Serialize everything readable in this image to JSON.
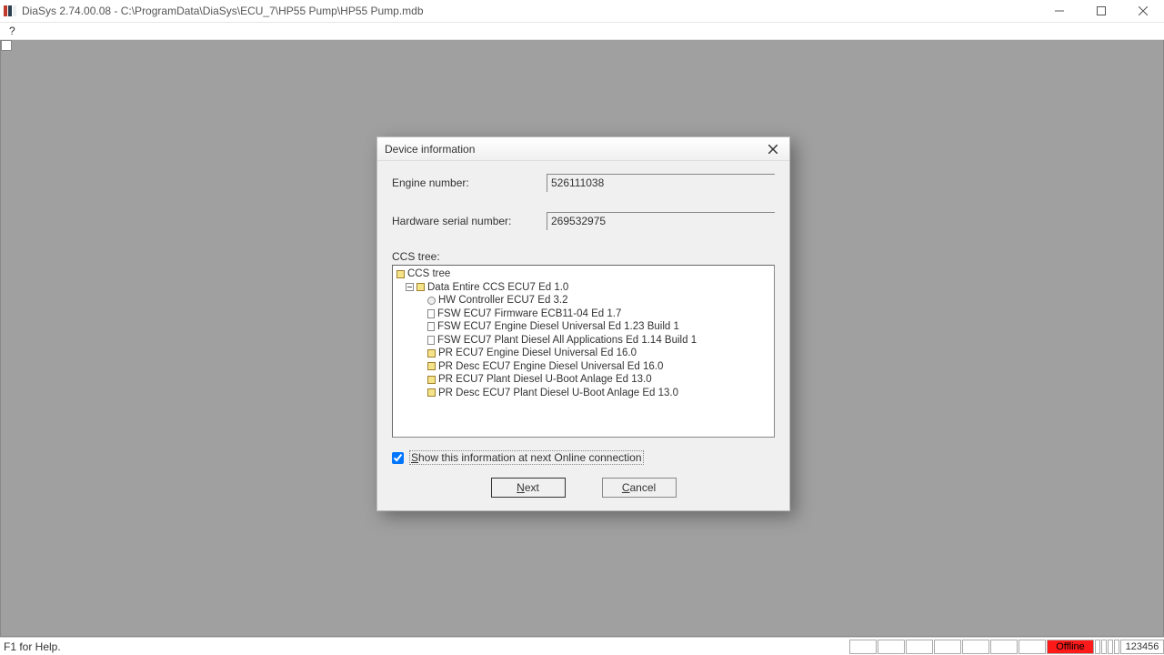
{
  "window": {
    "title": "DiaSys 2.74.00.08 - C:\\ProgramData\\DiaSys\\ECU_7\\HP55 Pump\\HP55 Pump.mdb",
    "menu_help": "?"
  },
  "dialog": {
    "title": "Device information",
    "engine_label": "Engine number:",
    "engine_value": "526111038",
    "hw_label": "Hardware serial number:",
    "hw_value": "269532975",
    "tree_label": "CCS tree:",
    "tree": {
      "root": "CCS tree",
      "level1": "Data Entire CCS ECU7 Ed 1.0",
      "items": [
        "HW Controller ECU7 Ed 3.2",
        "FSW ECU7 Firmware ECB11-04 Ed 1.7",
        "FSW ECU7 Engine Diesel Universal Ed 1.23 Build 1",
        "FSW ECU7 Plant Diesel All Applications Ed 1.14 Build 1",
        "PR ECU7 Engine Diesel Universal Ed 16.0",
        "PR Desc ECU7 Engine Diesel Universal Ed 16.0",
        "PR ECU7 Plant Diesel U-Boot Anlage Ed 13.0",
        "PR Desc ECU7 Plant Diesel U-Boot Anlage Ed 13.0"
      ]
    },
    "checkbox_s": "S",
    "checkbox_rest": "how this information at next Online connection",
    "next_n": "N",
    "next_rest": "ext",
    "cancel_c": "C",
    "cancel_rest": "ancel"
  },
  "status": {
    "help": "F1 for Help.",
    "offline": "Offline",
    "num": "123456"
  }
}
